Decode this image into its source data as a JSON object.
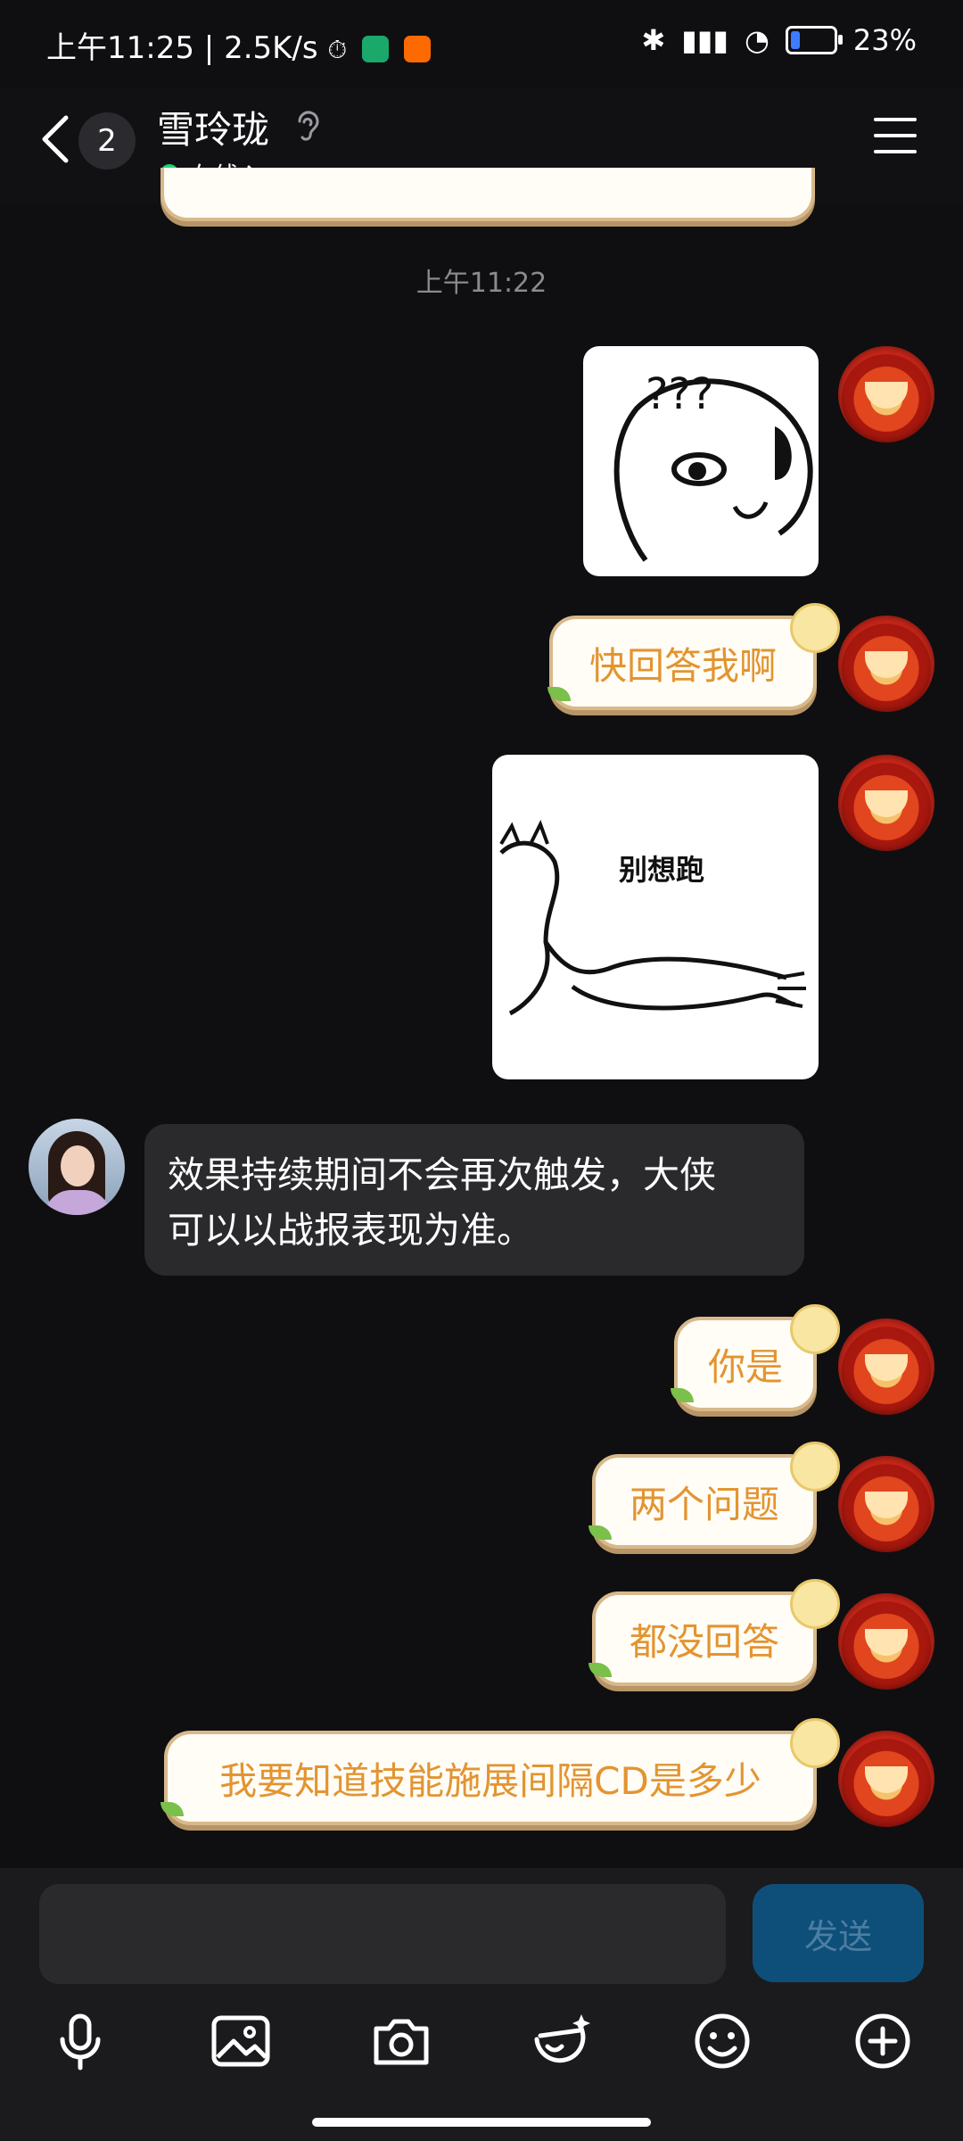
{
  "status_bar": {
    "time": "上午11:25",
    "net_speed": "2.5K/s",
    "battery": "23%"
  },
  "header": {
    "unread_count": "2",
    "contact_name": "雪玲珑",
    "presence": "在线"
  },
  "timestamp": "上午11:22",
  "messages": {
    "m1": "快回答我啊",
    "sticker2_text": "别想跑",
    "recv_1": "效果持续期间不会再次触发，大侠",
    "recv_2": "可以以战报表现为准。",
    "m3": "你是",
    "m4": "两个问题",
    "m5": "都没回答",
    "m6": "我要知道技能施展间隔CD是多少"
  },
  "input": {
    "send_label": "发送",
    "placeholder": ""
  },
  "toolbar": {
    "icons": [
      "microphone-icon",
      "image-icon",
      "camera-icon",
      "face-edit-icon",
      "emoji-icon",
      "plus-icon"
    ]
  },
  "colors": {
    "bubble_text": "#e39431",
    "bubble_bg": "#fffdf6",
    "send_button": "#0e4f7a",
    "online": "#22d46b"
  }
}
